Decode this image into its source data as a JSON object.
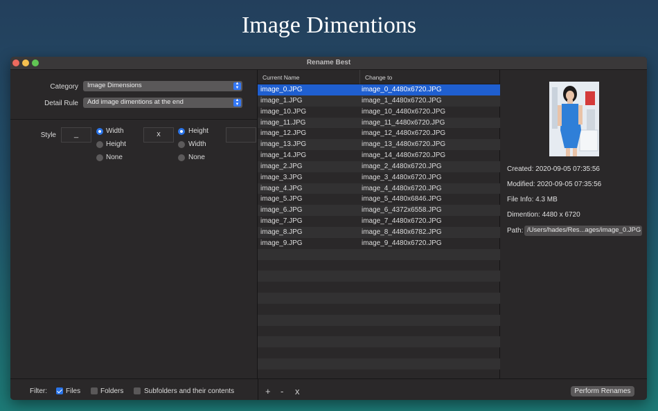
{
  "page": {
    "title": "Image Dimentions"
  },
  "window": {
    "title": "Rename Best"
  },
  "form": {
    "category_label": "Category",
    "category_value": "Image Dimensions",
    "detail_rule_label": "Detail Rule",
    "detail_rule_value": "Add image dimentions at the end",
    "style_label": "Style",
    "prefix_value": "_",
    "separator_value": "x",
    "suffix_value": "",
    "first_group": [
      {
        "label": "Width",
        "selected": true
      },
      {
        "label": "Height",
        "selected": false
      },
      {
        "label": "None",
        "selected": false
      }
    ],
    "second_group": [
      {
        "label": "Height",
        "selected": true
      },
      {
        "label": "Width",
        "selected": false
      },
      {
        "label": "None",
        "selected": false
      }
    ]
  },
  "table": {
    "columns": [
      "Current Name",
      "Change to"
    ],
    "rows": [
      {
        "current": "image_0.JPG",
        "new": "image_0_4480x6720.JPG",
        "selected": true
      },
      {
        "current": "image_1.JPG",
        "new": "image_1_4480x6720.JPG"
      },
      {
        "current": "image_10.JPG",
        "new": "image_10_4480x6720.JPG"
      },
      {
        "current": "image_11.JPG",
        "new": "image_11_4480x6720.JPG"
      },
      {
        "current": "image_12.JPG",
        "new": "image_12_4480x6720.JPG"
      },
      {
        "current": "image_13.JPG",
        "new": "image_13_4480x6720.JPG"
      },
      {
        "current": "image_14.JPG",
        "new": "image_14_4480x6720.JPG"
      },
      {
        "current": "image_2.JPG",
        "new": "image_2_4480x6720.JPG"
      },
      {
        "current": "image_3.JPG",
        "new": "image_3_4480x6720.JPG"
      },
      {
        "current": "image_4.JPG",
        "new": "image_4_4480x6720.JPG"
      },
      {
        "current": "image_5.JPG",
        "new": "image_5_4480x6846.JPG"
      },
      {
        "current": "image_6.JPG",
        "new": "image_6_4372x6558.JPG"
      },
      {
        "current": "image_7.JPG",
        "new": "image_7_4480x6720.JPG"
      },
      {
        "current": "image_8.JPG",
        "new": "image_8_4480x6782.JPG"
      },
      {
        "current": "image_9.JPG",
        "new": "image_9_4480x6720.JPG"
      },
      {
        "current": "",
        "new": ""
      },
      {
        "current": "",
        "new": ""
      },
      {
        "current": "",
        "new": ""
      },
      {
        "current": "",
        "new": ""
      },
      {
        "current": "",
        "new": ""
      },
      {
        "current": "",
        "new": ""
      },
      {
        "current": "",
        "new": ""
      },
      {
        "current": "",
        "new": ""
      },
      {
        "current": "",
        "new": ""
      },
      {
        "current": "",
        "new": ""
      },
      {
        "current": "",
        "new": ""
      },
      {
        "current": "",
        "new": ""
      }
    ]
  },
  "info": {
    "created": "Created: 2020-09-05 07:35:56",
    "modified": "Modified: 2020-09-05 07:35:56",
    "file_info": "File Info: 4.3 MB",
    "dimention": "Dimention: 4480 x 6720",
    "path_label": "Path:",
    "path_value": "/Users/hades/Res...ages/image_0.JPG"
  },
  "bottom": {
    "filter_label": "Filter:",
    "files_label": "Files",
    "files_checked": true,
    "folders_label": "Folders",
    "folders_checked": false,
    "subfolders_label": "Subfolders and their contents",
    "subfolders_checked": false,
    "add_label": "+",
    "remove_label": "-",
    "clear_label": "x",
    "perform_label": "Perform Renames"
  },
  "colors": {
    "accent": "#2a74e8",
    "selection": "#1f5fd0",
    "window_bg": "#2a2829"
  }
}
